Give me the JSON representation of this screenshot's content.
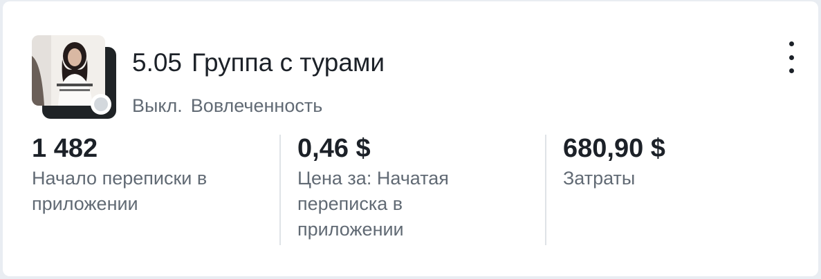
{
  "campaign": {
    "number": "5.05",
    "name": "Группа с турами",
    "status": "Выкл.",
    "objective": "Вовлеченность"
  },
  "metrics": [
    {
      "value": "1 482",
      "label": "Начало переписки в приложении"
    },
    {
      "value": "0,46 $",
      "label": "Цена за: Начатая переписка в приложении"
    },
    {
      "value": "680,90 $",
      "label": "Затраты"
    }
  ],
  "colors": {
    "status_off": "#d3d8dd",
    "text_primary": "#1c2128",
    "text_secondary": "#616a74"
  }
}
